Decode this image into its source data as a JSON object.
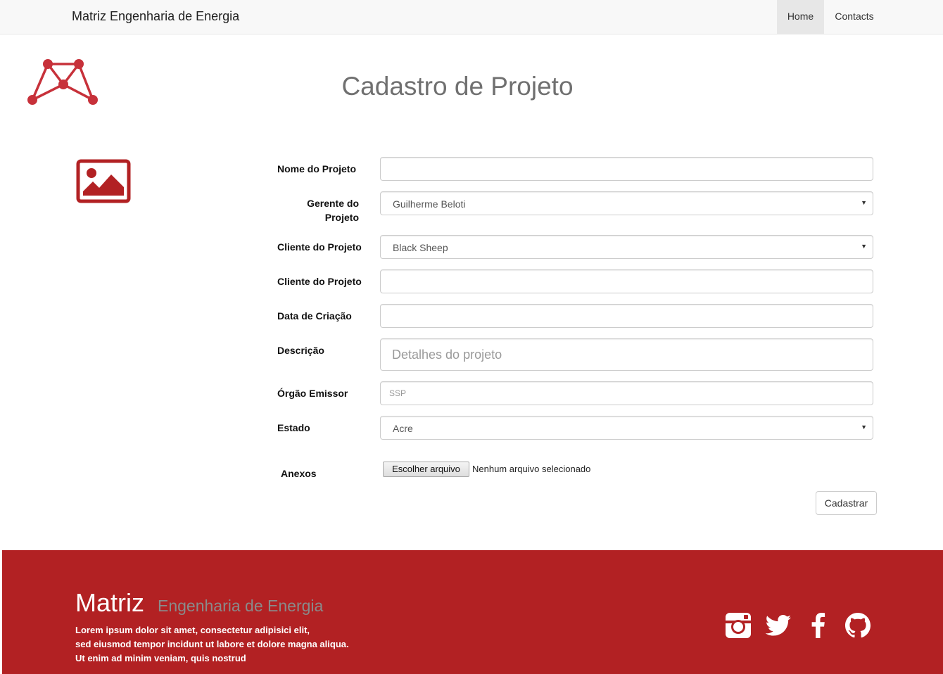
{
  "navbar": {
    "brand": "Matriz Engenharia de Energia",
    "items": [
      {
        "label": "Home",
        "active": true
      },
      {
        "label": "Contacts",
        "active": false
      }
    ]
  },
  "page": {
    "title": "Cadastro de Projeto"
  },
  "form": {
    "nome": {
      "label": "Nome do Projeto",
      "value": ""
    },
    "gerente": {
      "label_line1": "Gerente do",
      "label_line2": "Projeto",
      "selected": "Guilherme Beloti"
    },
    "cliente_select": {
      "label": "Cliente do Projeto",
      "selected": "Black Sheep"
    },
    "cliente_input": {
      "label": "Cliente do Projeto",
      "value": ""
    },
    "data_criacao": {
      "label": "Data de Criação",
      "value": ""
    },
    "descricao": {
      "label": "Descrição",
      "placeholder": "Detalhes do projeto"
    },
    "orgao": {
      "label": "Órgão Emissor",
      "placeholder": "SSP"
    },
    "estado": {
      "label": "Estado",
      "selected": "Acre"
    },
    "anexos": {
      "label": "Anexos",
      "button": "Escolher arquivo",
      "status": "Nenhum arquivo selecionado"
    },
    "submit_label": "Cadastrar"
  },
  "footer": {
    "title": "Matriz",
    "subtitle": "Engenharia de Energia",
    "lines": [
      "Lorem ipsum dolor sit amet, consectetur adipisici elit,",
      "sed eiusmod tempor incidunt ut labore et dolore magna aliqua.",
      "Ut enim ad minim veniam, quis nostrud"
    ],
    "social_icons": [
      "instagram-icon",
      "twitter-icon",
      "facebook-icon",
      "github-icon"
    ]
  },
  "colors": {
    "brand_red": "#b22123",
    "logo_red": "#c7313a",
    "navbar_bg": "#f8f8f8"
  }
}
